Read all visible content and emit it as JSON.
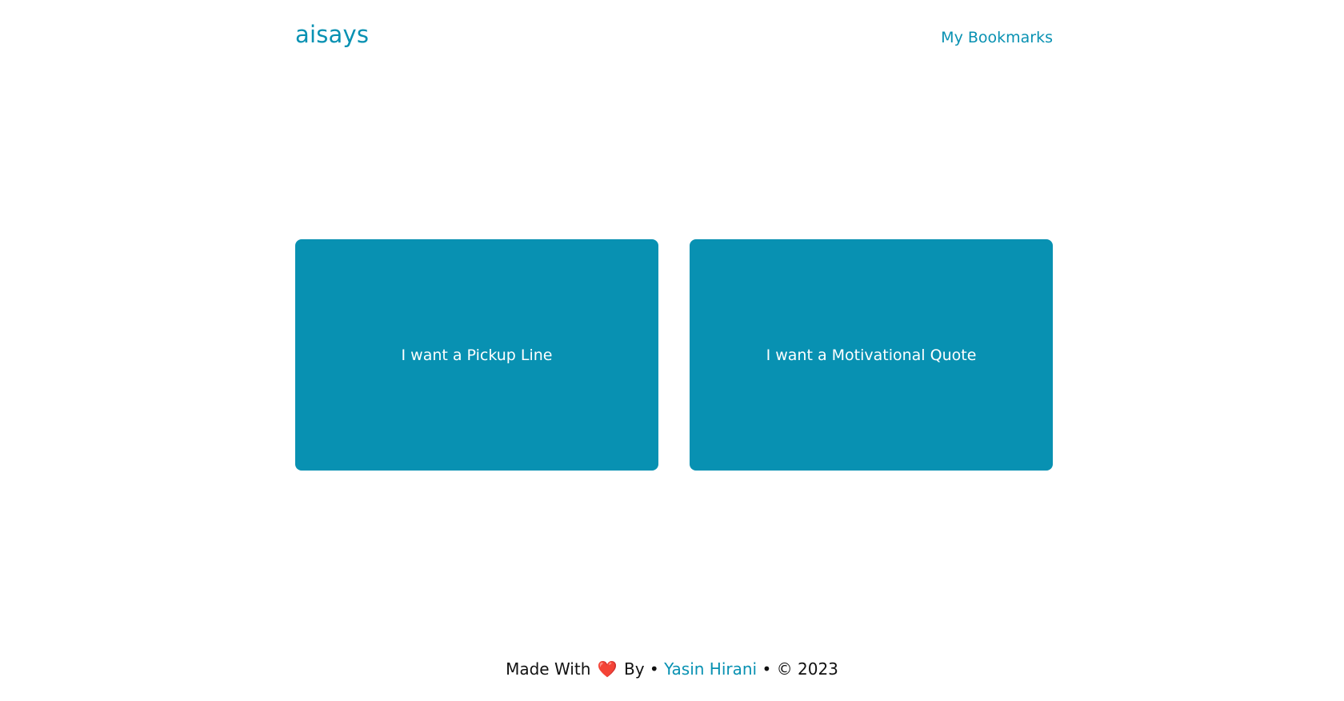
{
  "header": {
    "logo": "aisays",
    "bookmarks_link": "My Bookmarks"
  },
  "cards": [
    {
      "label": "I want a Pickup Line"
    },
    {
      "label": "I want a Motivational Quote"
    }
  ],
  "footer": {
    "made_with": "Made With",
    "heart_icon": "❤️",
    "by": "By •",
    "author": "Yasin Hirani",
    "copyright": "• © 2023"
  },
  "colors": {
    "accent": "#0891b2",
    "heart": "#e53e3e"
  }
}
